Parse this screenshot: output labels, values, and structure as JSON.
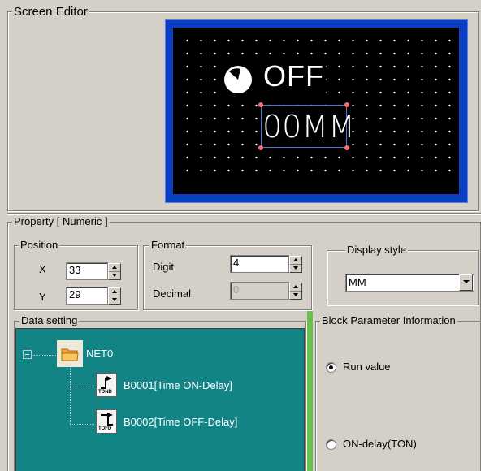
{
  "screen_editor": {
    "legend": "Screen Editor",
    "lcd": {
      "status_text": "OFF",
      "numeric_text": "00MM"
    }
  },
  "property": {
    "legend": "Property [ Numeric ]",
    "position": {
      "legend": "Position",
      "x_label": "X",
      "x_value": "33",
      "y_label": "Y",
      "y_value": "29"
    },
    "format": {
      "legend": "Format",
      "digit_label": "Digit",
      "digit_value": "4",
      "decimal_label": "Decimal",
      "decimal_value": "0"
    },
    "display_style": {
      "legend": "Display style",
      "selected": "MM"
    },
    "data_setting": {
      "legend": "Data setting",
      "tree": {
        "root": "NET0",
        "children": [
          {
            "label": "B0001[Time ON-Delay]",
            "icon_caption": "TOND"
          },
          {
            "label": "B0002[Time OFF-Delay]",
            "icon_caption": "TOFD"
          }
        ]
      }
    },
    "block_parameter": {
      "legend": "Block Parameter Information",
      "options": [
        "Run value",
        "ON-delay(TON)"
      ],
      "selected_index": 0
    }
  },
  "colors": {
    "tree_background": "#138486",
    "lcd_frame": "#0a3fc2",
    "divider_green": "#66c04a"
  }
}
